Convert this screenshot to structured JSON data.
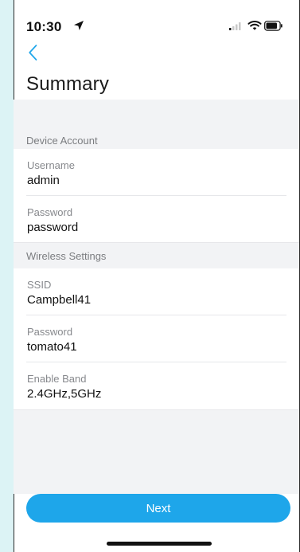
{
  "status_bar": {
    "time": "10:30",
    "icons": {
      "location": "location-arrow-icon",
      "signal": "cellular-signal-icon",
      "wifi": "wifi-icon",
      "battery": "battery-icon"
    }
  },
  "navigation": {
    "back_icon": "chevron-left-icon"
  },
  "page": {
    "title": "Summary"
  },
  "sections": [
    {
      "title": "Device Account",
      "fields": [
        {
          "label": "Username",
          "value": "admin"
        },
        {
          "label": "Password",
          "value": "password"
        }
      ]
    },
    {
      "title": "Wireless Settings",
      "fields": [
        {
          "label": "SSID",
          "value": "Campbell41"
        },
        {
          "label": "Password",
          "value": "tomato41"
        },
        {
          "label": "Enable Band",
          "value": "2.4GHz,5GHz"
        }
      ]
    }
  ],
  "actions": {
    "next_label": "Next"
  },
  "colors": {
    "background": "#dcf3f5",
    "accent": "#1ea6ea",
    "section_background": "#f2f3f5",
    "text": "#111111",
    "secondary_text": "#87898d"
  }
}
